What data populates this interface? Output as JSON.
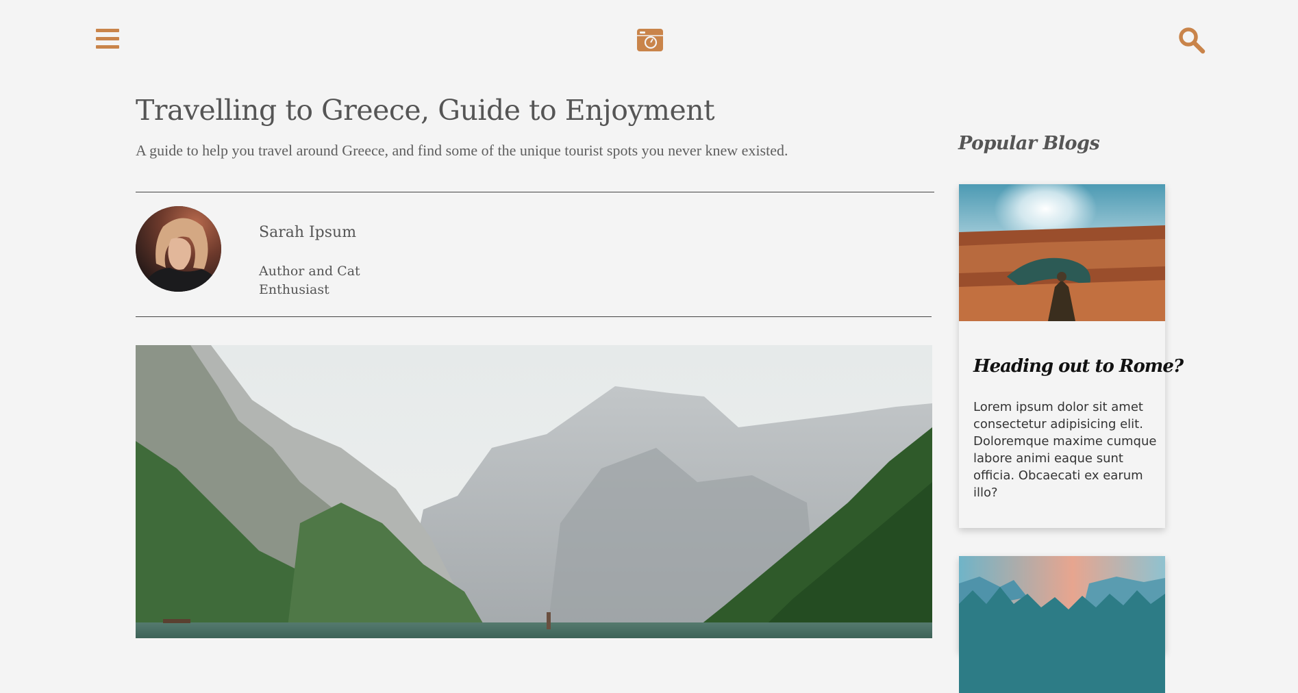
{
  "header": {
    "menu_icon": "hamburger-menu-icon",
    "logo_icon": "camera-logo-icon",
    "search_icon": "search-icon",
    "accent_color": "#c9844a"
  },
  "article": {
    "title": "Travelling to Greece, Guide to Enjoyment",
    "subtitle": "A guide to help you travel around Greece, and find some of the unique tourist spots you never knew existed.",
    "author": {
      "name": "Sarah Ipsum",
      "role": "Author and Cat Enthusiast"
    }
  },
  "sidebar": {
    "heading": "Popular Blogs",
    "cards": [
      {
        "title": "Heading out to Rome?",
        "text": "Lorem ipsum dolor sit amet consectetur adipisicing elit. Doloremque maxime cumque labore animi eaque sunt officia. Obcaecati ex earum illo?"
      }
    ]
  }
}
